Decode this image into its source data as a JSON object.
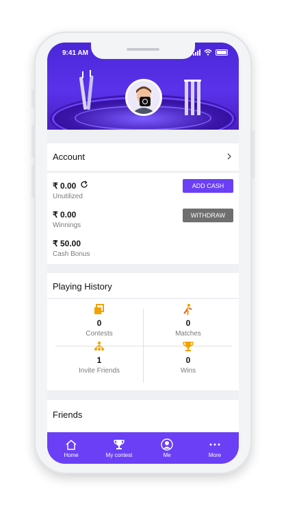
{
  "status_bar": {
    "time": "9:41 AM"
  },
  "account": {
    "title": "Account"
  },
  "wallet": {
    "unutilized_amount": "₹ 0.00",
    "unutilized_label": "Unutilized",
    "winnings_amount": "₹ 0.00",
    "winnings_label": "Winnings",
    "bonus_amount": "₹ 50.00",
    "bonus_label": "Cash Bonus",
    "add_cash_label": "ADD CASH",
    "withdraw_label": "WITHDRAW"
  },
  "playing_history": {
    "title": "Playing History",
    "stats": [
      {
        "value": "0",
        "label": "Contests",
        "icon": "contests-icon"
      },
      {
        "value": "0",
        "label": "Matches",
        "icon": "cricket-player-icon"
      },
      {
        "value": "1",
        "label": "Invite Friends",
        "icon": "invite-friends-icon"
      },
      {
        "value": "0",
        "label": "Wins",
        "icon": "trophy-icon"
      }
    ]
  },
  "friends": {
    "title": "Friends"
  },
  "bottom_nav": [
    {
      "label": "Home",
      "icon": "home-icon"
    },
    {
      "label": "My contest",
      "icon": "trophy-icon"
    },
    {
      "label": "Me",
      "icon": "user-icon"
    },
    {
      "label": "More",
      "icon": "more-dots-icon"
    }
  ],
  "colors": {
    "accent": "#6a3ff5",
    "header": "#4b27d8",
    "withdraw_button": "#6f6f6f",
    "stat_icon": "#f4a100"
  }
}
